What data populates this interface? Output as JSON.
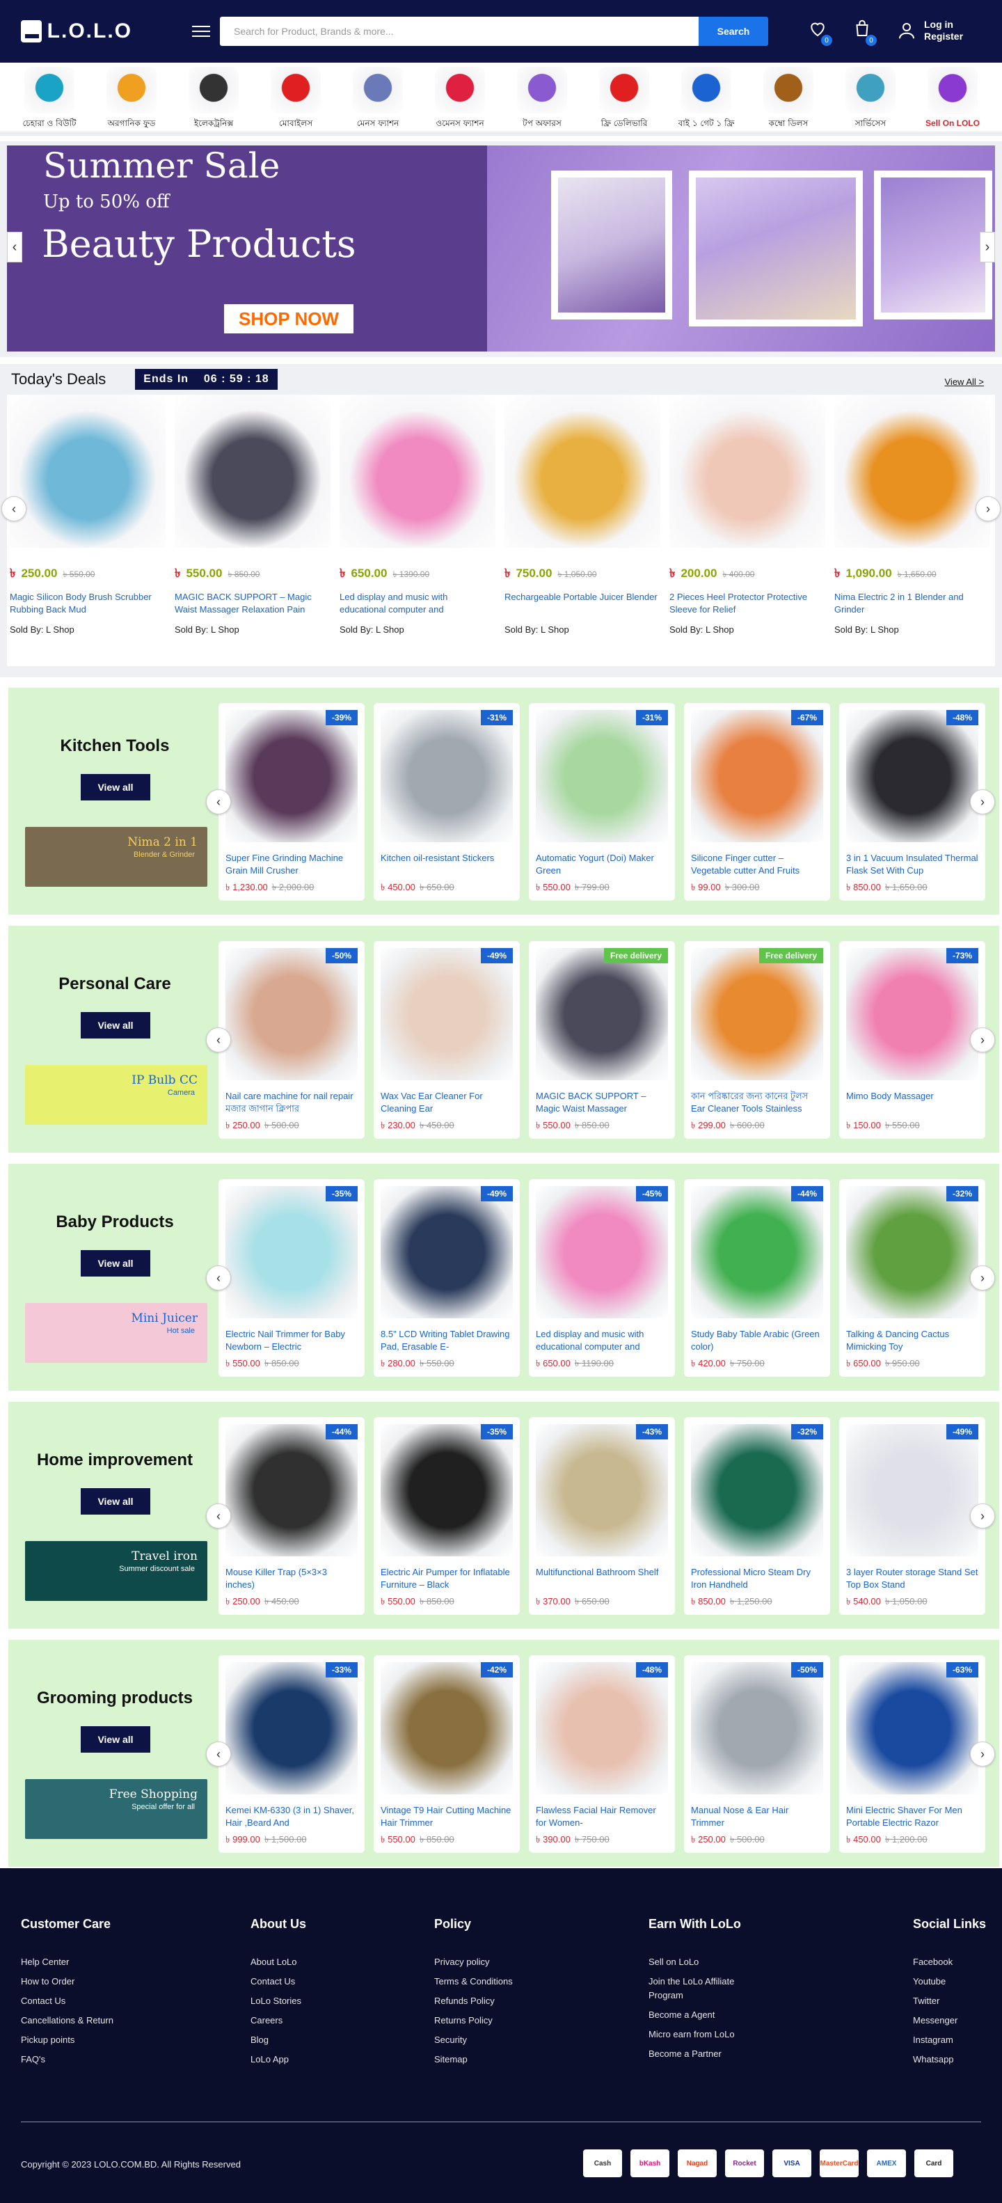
{
  "header": {
    "logo_text": "L.O.L.O",
    "search_placeholder": "Search for Product, Brands & more...",
    "search_button": "Search",
    "wishlist_count": "0",
    "cart_count": "0",
    "login": "Log in",
    "register": "Register"
  },
  "categories": [
    {
      "label": "চেহারা ও বিউটি",
      "color": "#1aa3c4"
    },
    {
      "label": "অরগানিক ফুড",
      "color": "#f0a020"
    },
    {
      "label": "ইলেকট্রনিক্স",
      "color": "#333333"
    },
    {
      "label": "মোবাইলস",
      "color": "#e02020"
    },
    {
      "label": "মেনস ফ্যাশন",
      "color": "#6a7ab8"
    },
    {
      "label": "ওমেনস ফ্যাশন",
      "color": "#e02040"
    },
    {
      "label": "টপ অফারস",
      "color": "#8a5ad0"
    },
    {
      "label": "ফ্রি ডেলিভারি",
      "color": "#e02020"
    },
    {
      "label": "বাই ১ গেট ১ ফ্রি",
      "color": "#1a63d0"
    },
    {
      "label": "কম্বো ডিলস",
      "color": "#a0601a"
    },
    {
      "label": "সার্ভিসেস",
      "color": "#40a0c0"
    },
    {
      "label": "Sell On LOLO",
      "color": "#8a3ad0"
    }
  ],
  "hero": {
    "title": "Summer Sale",
    "subtitle": "Up to 50% off",
    "headline": "Beauty Products",
    "cta": "SHOP NOW",
    "prev_arrow": "‹",
    "next_arrow": "›"
  },
  "deals": {
    "title": "Today's Deals",
    "ends_label": "Ends In",
    "timer": "06 : 59 : 18",
    "view_all": "View All >",
    "currency": "৳",
    "items": [
      {
        "price": "250.00",
        "old": "৳ 550.00",
        "name": "Magic Silicon Body Brush Scrubber Rubbing Back Mud",
        "seller": "Sold By: L Shop",
        "color": "#6fb8d8"
      },
      {
        "price": "550.00",
        "old": "৳ 850.00",
        "name": "MAGIC BACK SUPPORT – Magic Waist Massager Relaxation Pain",
        "seller": "Sold By: L Shop",
        "color": "#4a4a5a"
      },
      {
        "price": "650.00",
        "old": "৳ 1390.00",
        "name": "Led display and music with educational computer and",
        "seller": "Sold By: L Shop",
        "color": "#f08ac0"
      },
      {
        "price": "750.00",
        "old": "৳ 1,050.00",
        "name": "Rechargeable Portable Juicer Blender",
        "seller": "Sold By: L Shop",
        "color": "#e8b040"
      },
      {
        "price": "200.00",
        "old": "৳ 400.00",
        "name": "2 Pieces Heel Protector Protective Sleeve for Relief",
        "seller": "Sold By: L Shop",
        "color": "#f0c8b8"
      },
      {
        "price": "1,090.00",
        "old": "৳ 1,650.00",
        "name": "Nima Electric 2 in 1 Blender and Grinder",
        "seller": "Sold By: L Shop",
        "color": "#e89020"
      }
    ]
  },
  "sections": [
    {
      "title": "Kitchen Tools",
      "view_all": "View all",
      "banner_title": "Nima 2 in 1",
      "banner_sub": "Blender & Grinder",
      "banner_bg": "#7a6a50",
      "banner_fg": "#f5d060",
      "products": [
        {
          "badge": "-39%",
          "name": "Super Fine Grinding Machine Grain Mill Crusher",
          "price": "৳ 1,230.00",
          "old": "৳ 2,000.00",
          "color": "#5a3a5a"
        },
        {
          "badge": "-31%",
          "name": "Kitchen oil-resistant Stickers",
          "price": "৳ 450.00",
          "old": "৳ 650.00",
          "color": "#a0a8b0"
        },
        {
          "badge": "-31%",
          "name": "Automatic Yogurt (Doi) Maker Green",
          "price": "৳ 550.00",
          "old": "৳ 799.00",
          "color": "#a8d8a0"
        },
        {
          "badge": "-67%",
          "name": "Silicone Finger cutter – Vegetable cutter And Fruits",
          "price": "৳ 99.00",
          "old": "৳ 300.00",
          "color": "#e88040"
        },
        {
          "badge": "-48%",
          "name": "3 in 1 Vacuum Insulated Thermal Flask Set With Cup",
          "price": "৳ 850.00",
          "old": "৳ 1,650.00",
          "color": "#2a2a30"
        }
      ]
    },
    {
      "title": "Personal Care",
      "view_all": "View all",
      "banner_title": "IP Bulb CC",
      "banner_sub": "Camera",
      "banner_bg": "#e8f070",
      "banner_fg": "#1a63d0",
      "products": [
        {
          "badge": "-50%",
          "name": "Nail care machine for nail repair মজার জাগান ক্লিপার",
          "price": "৳ 250.00",
          "old": "৳ 500.00",
          "color": "#d8a890"
        },
        {
          "badge": "-49%",
          "name": "Wax Vac Ear Cleaner For Cleaning Ear",
          "price": "৳ 230.00",
          "old": "৳ 450.00",
          "color": "#e8d0c0"
        },
        {
          "badge": "Free delivery",
          "name": "MAGIC BACK SUPPORT – Magic Waist Massager",
          "price": "৳ 550.00",
          "old": "৳ 850.00",
          "color": "#4a4a5a"
        },
        {
          "badge": "Free delivery",
          "name": "কান পরিষ্কারের জন্য কানের টুলস Ear Cleaner Tools Stainless",
          "price": "৳ 299.00",
          "old": "৳ 600.00",
          "color": "#e88a30"
        },
        {
          "badge": "-73%",
          "name": "Mimo Body Massager",
          "price": "৳ 150.00",
          "old": "৳ 550.00",
          "color": "#f080b0"
        }
      ]
    },
    {
      "title": "Baby Products",
      "view_all": "View all",
      "banner_title": "Mini Juicer",
      "banner_sub": "Hot sale",
      "banner_bg": "#f5c8d8",
      "banner_fg": "#1a63d0",
      "products": [
        {
          "badge": "-35%",
          "name": "Electric Nail Trimmer for Baby Newborn – Electric",
          "price": "৳ 550.00",
          "old": "৳ 850.00",
          "color": "#a8e0e8"
        },
        {
          "badge": "-49%",
          "name": "8.5\" LCD Writing Tablet Drawing Pad, Erasable E-",
          "price": "৳ 280.00",
          "old": "৳ 550.00",
          "color": "#2a3a5a"
        },
        {
          "badge": "-45%",
          "name": "Led display and music with educational computer and",
          "price": "৳ 650.00",
          "old": "৳ 1190.00",
          "color": "#f08ac0"
        },
        {
          "badge": "-44%",
          "name": "Study Baby Table Arabic (Green color)",
          "price": "৳ 420.00",
          "old": "৳ 750.00",
          "color": "#40b050"
        },
        {
          "badge": "-32%",
          "name": "Talking & Dancing Cactus Mimicking Toy",
          "price": "৳ 650.00",
          "old": "৳ 950.00",
          "color": "#60a040"
        }
      ]
    },
    {
      "title": "Home improvement",
      "view_all": "View all",
      "banner_title": "Travel iron",
      "banner_sub": "Summer discount sale",
      "banner_bg": "#0e4a4a",
      "banner_fg": "#ffffff",
      "products": [
        {
          "badge": "-44%",
          "name": "Mouse Killer Trap (5×3×3 inches)",
          "price": "৳ 250.00",
          "old": "৳ 450.00",
          "color": "#303030"
        },
        {
          "badge": "-35%",
          "name": "Electric Air Pumper for Inflatable Furniture – Black",
          "price": "৳ 550.00",
          "old": "৳ 850.00",
          "color": "#202020"
        },
        {
          "badge": "-43%",
          "name": "Multifunctional Bathroom Shelf",
          "price": "৳ 370.00",
          "old": "৳ 650.00",
          "color": "#c8b890"
        },
        {
          "badge": "-32%",
          "name": "Professional Micro Steam Dry Iron Handheld",
          "price": "৳ 850.00",
          "old": "৳ 1,250.00",
          "color": "#1a6a50"
        },
        {
          "badge": "-49%",
          "name": "3 layer Router storage Stand Set Top Box Stand",
          "price": "৳ 540.00",
          "old": "৳ 1,050.00",
          "color": "#e0e0e8"
        }
      ]
    },
    {
      "title": "Grooming products",
      "view_all": "View all",
      "banner_title": "Free Shopping",
      "banner_sub": "Special offer for all",
      "banner_bg": "#2a6a70",
      "banner_fg": "#ffffff",
      "products": [
        {
          "badge": "-33%",
          "name": "Kemei KM-6330 (3 in 1) Shaver, Hair ,Beard And",
          "price": "৳ 999.00",
          "old": "৳ 1,500.00",
          "color": "#1a3a6a"
        },
        {
          "badge": "-42%",
          "name": "Vintage T9 Hair Cutting Machine Hair Trimmer",
          "price": "৳ 550.00",
          "old": "৳ 850.00",
          "color": "#8a7040"
        },
        {
          "badge": "-48%",
          "name": "Flawless Facial Hair Remover for Women-",
          "price": "৳ 390.00",
          "old": "৳ 750.00",
          "color": "#e8c0b0"
        },
        {
          "badge": "-50%",
          "name": "Manual Nose & Ear Hair Trimmer",
          "price": "৳ 250.00",
          "old": "৳ 500.00",
          "color": "#a0a8b0"
        },
        {
          "badge": "-63%",
          "name": "Mini Electric Shaver For Men Portable Electric Razor",
          "price": "৳ 450.00",
          "old": "৳ 1,200.00",
          "color": "#1a4aa0"
        }
      ]
    }
  ],
  "footer": {
    "columns": [
      {
        "title": "Customer Care",
        "links": [
          "Help Center",
          "How to Order",
          "Contact Us",
          "Cancellations & Return",
          "Pickup points",
          "FAQ's"
        ]
      },
      {
        "title": "About Us",
        "links": [
          "About LoLo",
          "Contact Us",
          "LoLo Stories",
          "Careers",
          "Blog",
          "LoLo App"
        ]
      },
      {
        "title": "Policy",
        "links": [
          "Privacy policy",
          "Terms & Conditions",
          "Refunds Policy",
          "Returns Policy",
          "Security",
          "Sitemap"
        ]
      },
      {
        "title": "Earn With LoLo",
        "links": [
          "Sell on LoLo",
          "Join the LoLo Affiliate Program",
          "Become a Agent",
          "Micro earn from LoLo",
          "Become a Partner"
        ]
      },
      {
        "title": "Social Links",
        "links": [
          "Facebook",
          "Youtube",
          "Twitter",
          "Messenger",
          "Instagram",
          "Whatsapp"
        ]
      }
    ],
    "copyright": "Copyright © 2023 LOLO.COM.BD. All Rights Reserved",
    "payments": [
      {
        "name": "Cash",
        "color": "#333333"
      },
      {
        "name": "bKash",
        "color": "#e2136e"
      },
      {
        "name": "Nagad",
        "color": "#e8401c"
      },
      {
        "name": "Rocket",
        "color": "#8a2a8a"
      },
      {
        "name": "VISA",
        "color": "#1a3a9a"
      },
      {
        "name": "MasterCard",
        "color": "#e8501c"
      },
      {
        "name": "AMEX",
        "color": "#2a6ab8"
      },
      {
        "name": "Card",
        "color": "#222222"
      }
    ]
  }
}
